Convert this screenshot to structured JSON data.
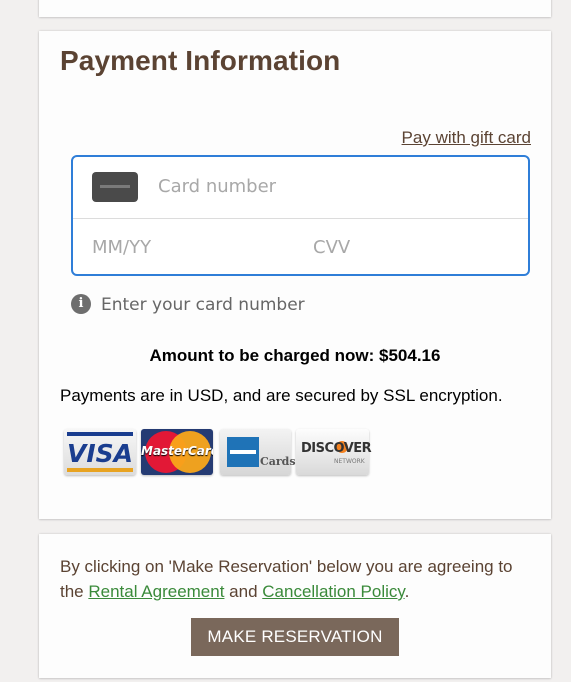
{
  "payment": {
    "title": "Payment Information",
    "gift_link": "Pay with gift card",
    "card_number_placeholder": "Card number",
    "expiry_placeholder": "MM/YY",
    "cvv_placeholder": "CVV",
    "hint_icon": "info-icon",
    "hint_text": "Enter your card number",
    "amount_text": "Amount to be charged now: $504.16",
    "usd_note": "Payments are in USD, and are secured by SSL encryption.",
    "logos": [
      {
        "name": "visa-logo",
        "text": "VISA"
      },
      {
        "name": "mastercard-logo",
        "text": "MasterCard"
      },
      {
        "name": "amex-logo",
        "text": "Cards"
      },
      {
        "name": "discover-logo",
        "text": "DISCOVER",
        "sub": "NETWORK"
      }
    ]
  },
  "terms": {
    "prefix": "By clicking on 'Make Reservation' below you are agreeing to the ",
    "rental_link": "Rental Agreement",
    "middle": " and ",
    "cancel_link": "Cancellation Policy",
    "suffix": ".",
    "button_label": "MAKE RESERVATION"
  },
  "colors": {
    "heading": "#5b4333",
    "focus_border": "#2f7ed8",
    "link_green": "#3a8a3a",
    "button_bg": "#7a685b"
  }
}
